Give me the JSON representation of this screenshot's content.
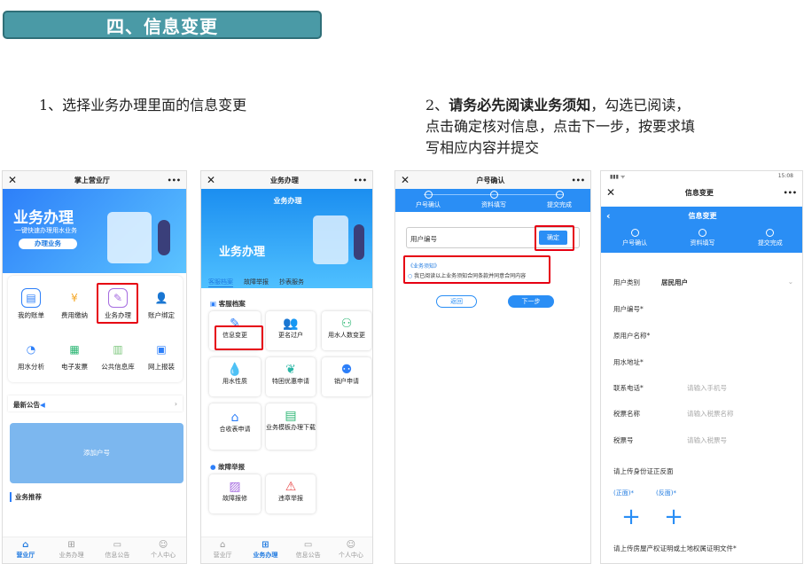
{
  "banner": "四、信息变更",
  "step1": "1、选择业务办理里面的信息变更",
  "step2": {
    "num": "2、",
    "bold": "请务必先阅读业务须知",
    "rest": "，勾选已阅读，点击确定核对信息，点击下一步，按要求填写相应内容并提交"
  },
  "p1": {
    "title": "掌上营业厅",
    "hero_title": "业务办理",
    "hero_sub": "一键快速办理用水业务",
    "hero_btn": "办理业务",
    "items": [
      "我的账单",
      "费用缴纳",
      "业务办理",
      "账户绑定",
      "用水分析",
      "电子发票",
      "公共信息库",
      "网上报装"
    ],
    "notice": "最新公告",
    "add": "添加户号",
    "recommend": "业务推荐",
    "tabs": [
      "营业厅",
      "业务办理",
      "信息公告",
      "个人中心"
    ]
  },
  "p2": {
    "title": "业务办理",
    "header": "业务办理",
    "hero_title": "业务办理",
    "tabs_top": [
      "客服档案",
      "故障举报",
      "抄表服务"
    ],
    "section1": "客服档案",
    "items": [
      "信息变更",
      "更名过户",
      "用水人数变更",
      "用水性质",
      "特困优惠申请",
      "销户申请",
      "合收表申请",
      "业务模板办理下载"
    ],
    "section2": "故障举报",
    "items2": [
      "故障报修",
      "违章举报"
    ],
    "tabs": [
      "营业厅",
      "业务办理",
      "信息公告",
      "个人中心"
    ]
  },
  "p3": {
    "title": "户号确认",
    "steps": [
      "户号确认",
      "资料填写",
      "提交完成"
    ],
    "field": "用户编号",
    "confirm": "确定",
    "notice_link": "《业务须知》",
    "notice_text": "我已阅读以上业务须知合同条款并同意合同内容",
    "back": "返回",
    "next": "下一步"
  },
  "p4": {
    "status_time": "15:08",
    "title": "信息变更",
    "header": "信息变更",
    "steps": [
      "户号确认",
      "资料填写",
      "提交完成"
    ],
    "rows": [
      {
        "label": "用户类别",
        "value": "居民用户"
      },
      {
        "label": "用户编号*",
        "value": ""
      },
      {
        "label": "原用户名称*",
        "value": ""
      },
      {
        "label": "用水地址*",
        "value": ""
      },
      {
        "label": "联系电话*",
        "value": "请输入手机号"
      },
      {
        "label": "税票名称",
        "value": "请输入税票名称"
      },
      {
        "label": "税票号",
        "value": "请输入税票号"
      }
    ],
    "upload": "请上传身份证正反面",
    "front": "(正面)*",
    "back": "(反面)*",
    "upload2": "请上传房屋产权证明或土地权属证明文件*"
  }
}
